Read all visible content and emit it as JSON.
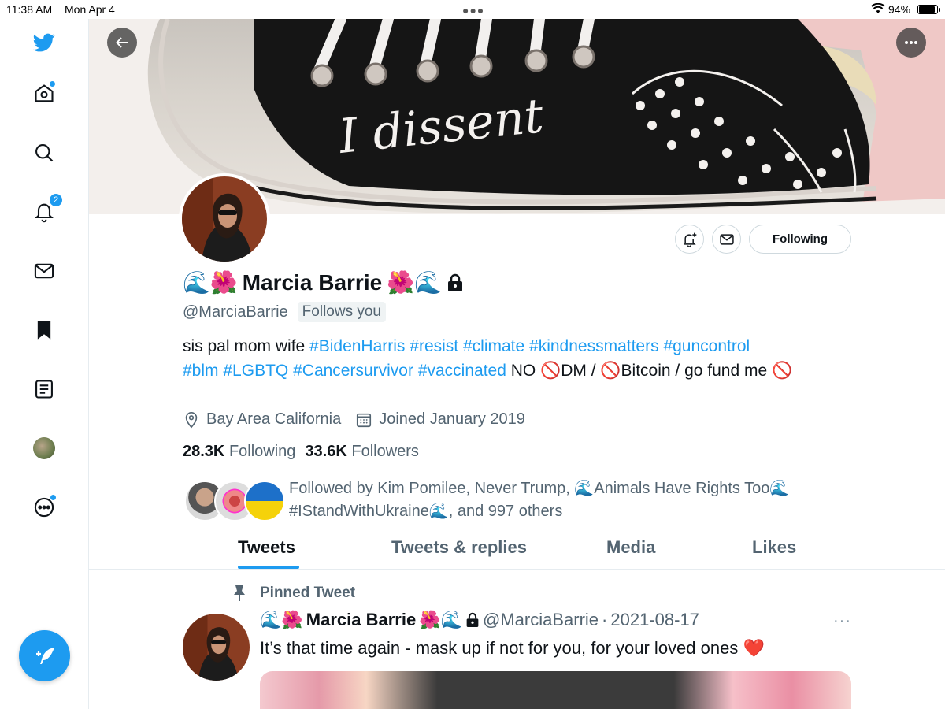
{
  "status_bar": {
    "time": "11:38 AM",
    "date": "Mon Apr 4",
    "battery": "94%",
    "battery_level": 0.94
  },
  "sidebar": {
    "items": [
      {
        "name": "twitter-logo-icon"
      },
      {
        "name": "home-icon",
        "has_dot": true
      },
      {
        "name": "search-icon"
      },
      {
        "name": "notifications-icon",
        "badge": "2"
      },
      {
        "name": "messages-icon"
      },
      {
        "name": "bookmarks-icon"
      },
      {
        "name": "lists-icon"
      },
      {
        "name": "profile-avatar"
      },
      {
        "name": "more-icon",
        "has_dot": true
      }
    ],
    "compose_icon": "compose-tweet-icon"
  },
  "banner": {
    "back_icon": "back-arrow-icon",
    "more_icon": "more-options-icon",
    "shoe_text": "I dissent"
  },
  "profile": {
    "name_prefix": "🌊🌺",
    "name": "Marcia Barrie",
    "name_suffix": "🌺🌊",
    "protected_icon": "lock-icon",
    "handle": "@MarciaBarrie",
    "follows_you": "Follows you",
    "following_button": "Following",
    "bio": {
      "p1": "sis pal mom wife ",
      "tags1": [
        "#BidenHarris",
        "#resist",
        "#climate",
        "#kindnessmatters",
        "#guncontrol",
        "#blm",
        "#LGBTQ",
        "#Cancersurvivor",
        "#vaccinated"
      ],
      "p2": " NO 🚫DM / 🚫Bitcoin / go fund me 🚫"
    },
    "location": "Bay Area California",
    "joined": "Joined January 2019",
    "following_count": "28.3K",
    "following_label": "Following",
    "followers_count": "33.6K",
    "followers_label": "Followers",
    "followed_by_text": "Followed by Kim Pomilee, Never Trump, 🌊Animals Have Rights Too🌊 #IStandWithUkraine🌊, and 997 others"
  },
  "tabs": [
    "Tweets",
    "Tweets & replies",
    "Media",
    "Likes"
  ],
  "pinned_tweet": {
    "label": "Pinned Tweet",
    "name_prefix": "🌊🌺",
    "name": "Marcia Barrie",
    "name_suffix": "🌺🌊",
    "handle": "@MarciaBarrie",
    "separator": "·",
    "date": "2021-08-17",
    "more": "···",
    "text": "It’s that time again - mask up if not for you, for your loved ones ❤️"
  },
  "colors": {
    "accent": "#1d9bf0",
    "text": "#0f1419",
    "secondary": "#536471"
  }
}
